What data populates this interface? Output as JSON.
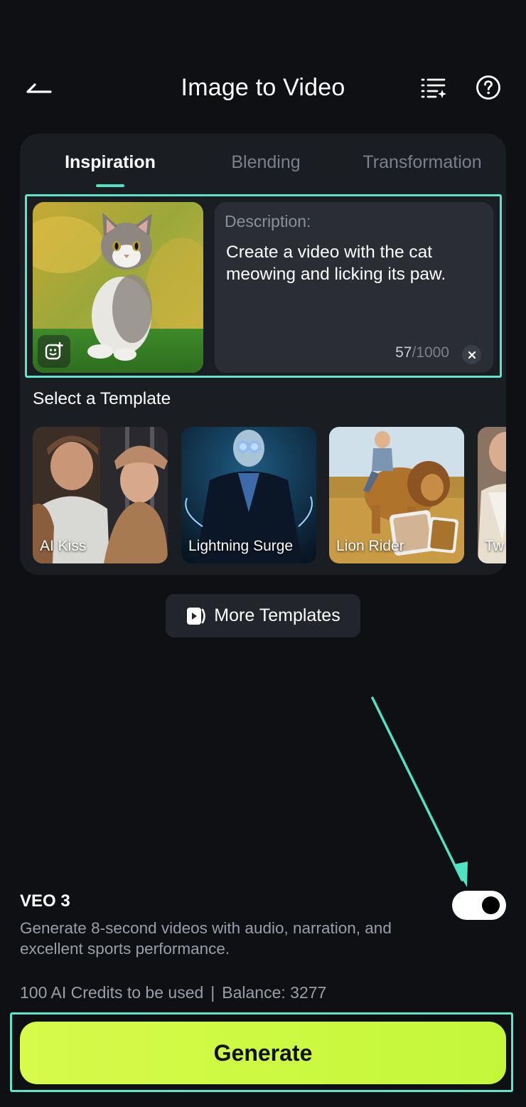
{
  "header": {
    "title": "Image to Video",
    "back_icon": "back-arrow-icon",
    "list_icon": "task-list-icon",
    "help_icon": "help-icon"
  },
  "tabs": [
    {
      "label": "Inspiration",
      "active": true
    },
    {
      "label": "Blending",
      "active": false
    },
    {
      "label": "Transformation",
      "active": false
    }
  ],
  "description": {
    "label": "Description:",
    "text": "Create a video with the cat meowing and licking its paw.",
    "count": "57",
    "max": "/1000"
  },
  "templates": {
    "title": "Select a Template",
    "items": [
      {
        "label": "AI Kiss"
      },
      {
        "label": "Lightning Surge"
      },
      {
        "label": "Lion Rider"
      },
      {
        "label": "Tw"
      }
    ]
  },
  "more_templates": {
    "label": "More Templates"
  },
  "veo": {
    "title": "VEO 3",
    "description": "Generate 8-second videos with audio, narration, and excellent sports performance.",
    "enabled": true
  },
  "credits": {
    "usage": "100 AI Credits to be used",
    "separator": "|",
    "balance": "Balance: 3277"
  },
  "generate": {
    "label": "Generate"
  },
  "colors": {
    "background": "#0e1014",
    "accent": "#4fe3c4",
    "generate": "#c8f83c",
    "card": "#1a1d22"
  }
}
